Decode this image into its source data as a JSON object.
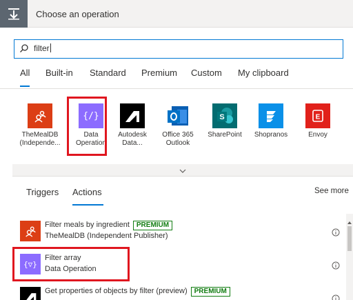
{
  "header": {
    "title": "Choose an operation",
    "icon": "operation-icon"
  },
  "search": {
    "value": "filter",
    "icon": "search-icon"
  },
  "tabs": [
    {
      "label": "All",
      "active": true
    },
    {
      "label": "Built-in"
    },
    {
      "label": "Standard"
    },
    {
      "label": "Premium"
    },
    {
      "label": "Custom"
    },
    {
      "label": "My clipboard"
    }
  ],
  "connectors": [
    {
      "label": "TheMealDB (Independe...",
      "color": "#dc3e15",
      "icon": "user-group-icon"
    },
    {
      "label": "Data Operation",
      "color": "#8c6cff",
      "icon": "curly-braces-icon"
    },
    {
      "label": "Autodesk Data...",
      "color": "#000000",
      "icon": "autodesk-icon"
    },
    {
      "label": "Office 365 Outlook",
      "color": "#0078d4",
      "icon": "outlook-icon"
    },
    {
      "label": "SharePoint",
      "color": "#036c70",
      "icon": "sharepoint-icon"
    },
    {
      "label": "Shopranoѕ",
      "color": "#0a90e8",
      "icon": "shopranos-icon"
    },
    {
      "label": "Envoy",
      "color": "#e1211b",
      "icon": "envoy-icon"
    }
  ],
  "sub_tabs": {
    "triggers": "Triggers",
    "actions": "Actions",
    "see_more": "See more"
  },
  "actions": [
    {
      "title": "Filter meals by ingredient",
      "badge": "PREMIUM",
      "subtitle": "TheMealDB (Independent Publisher)",
      "color": "#dc3e15",
      "icon": "user-group-icon"
    },
    {
      "title": "Filter array",
      "badge": "",
      "subtitle": "Data Operation",
      "color": "#8c6cff",
      "icon": "curly-braces-icon"
    },
    {
      "title": "Get properties of objects by filter (preview)",
      "badge": "PREMIUM",
      "subtitle": "",
      "color": "#000000",
      "icon": "autodesk-icon"
    }
  ],
  "colors": {
    "accent": "#0078d4",
    "highlight": "#e0161f",
    "premium": "#107c10"
  }
}
